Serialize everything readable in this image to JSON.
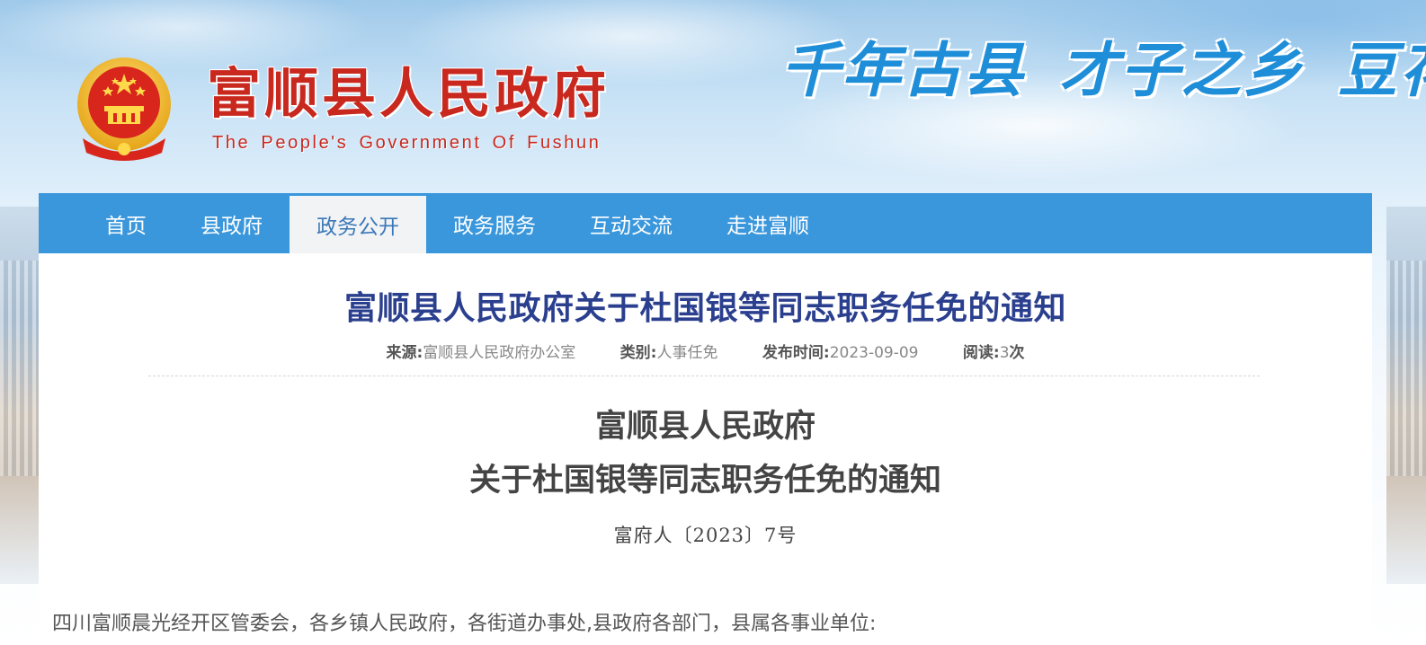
{
  "header": {
    "site_title": "富顺县人民政府",
    "site_subtitle": "The People's Government Of Fushun",
    "slogan": [
      "千年古县",
      "才子之乡",
      "豆花"
    ],
    "emblem_icon": "national-emblem-icon"
  },
  "nav": {
    "items": [
      {
        "label": "首页",
        "active": false
      },
      {
        "label": "县政府",
        "active": false
      },
      {
        "label": "政务公开",
        "active": true
      },
      {
        "label": "政务服务",
        "active": false
      },
      {
        "label": "互动交流",
        "active": false
      },
      {
        "label": "走进富顺",
        "active": false
      }
    ]
  },
  "article": {
    "title": "富顺县人民政府关于杜国银等同志职务任免的通知",
    "meta": {
      "source_label": "来源:",
      "source": "富顺县人民政府办公室",
      "category_label": "类别:",
      "category": "人事任免",
      "date_label": "发布时间:",
      "date": "2023-09-09",
      "views_label": "阅读:",
      "views": "3",
      "views_unit": "次"
    },
    "heading_line1": "富顺县人民政府",
    "heading_line2": "关于杜国银等同志职务任免的通知",
    "doc_number": "富府人〔2023〕7号",
    "salutation": "四川富顺晨光经开区管委会，各乡镇人民政府，各街道办事处,县政府各部门，县属各事业单位:"
  },
  "colors": {
    "nav_bg": "#3a97dc",
    "title_red": "#c8281e",
    "article_title_blue": "#2b3f8f",
    "slogan_blue": "#1f8ed8"
  }
}
